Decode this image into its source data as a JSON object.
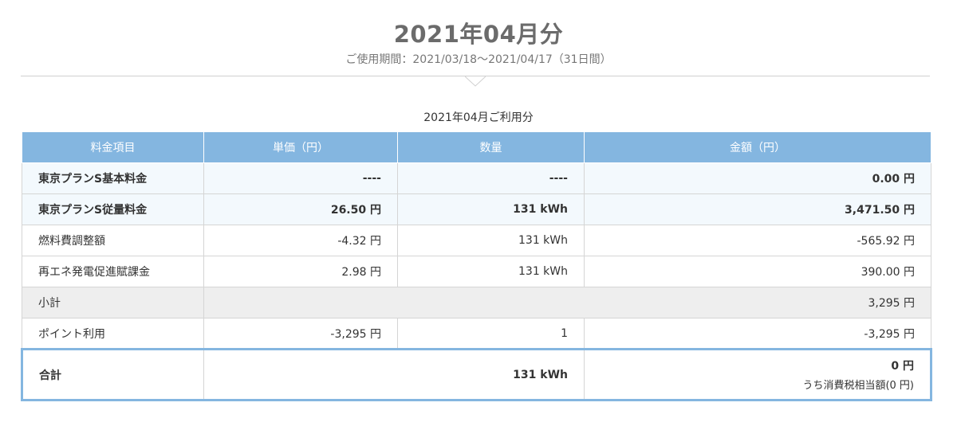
{
  "header": {
    "title": "2021年04月分",
    "period": "ご使用期間：2021/03/18～2021/04/17（31日間）"
  },
  "table": {
    "caption": "2021年04月ご利用分",
    "columns": [
      "料金項目",
      "単価（円）",
      "数量",
      "金額（円）"
    ],
    "rows": [
      {
        "item": "東京プランS基本料金",
        "unit_price": "----",
        "quantity": "----",
        "amount": "0.00 円"
      },
      {
        "item": "東京プランS従量料金",
        "unit_price": "26.50 円",
        "quantity": "131 kWh",
        "amount": "3,471.50 円"
      },
      {
        "item": "燃料費調整額",
        "unit_price": "-4.32 円",
        "quantity": "131 kWh",
        "amount": "-565.92 円"
      },
      {
        "item": "再エネ発電促進賦課金",
        "unit_price": "2.98 円",
        "quantity": "131 kWh",
        "amount": "390.00 円"
      }
    ],
    "subtotal": {
      "label": "小計",
      "amount": "3,295 円"
    },
    "points": {
      "item": "ポイント利用",
      "unit_price": "-3,295 円",
      "quantity": "1",
      "amount": "-3,295 円"
    },
    "total": {
      "label": "合計",
      "quantity": "131 kWh",
      "amount": "0 円",
      "tax_note": "うち消費税相当額(0 円)"
    }
  },
  "colors": {
    "header_bg": "#84b6e0",
    "title": "#6b6b6b",
    "highlight_row": "#f3f9fd",
    "subtotal_row": "#eeeeee"
  }
}
